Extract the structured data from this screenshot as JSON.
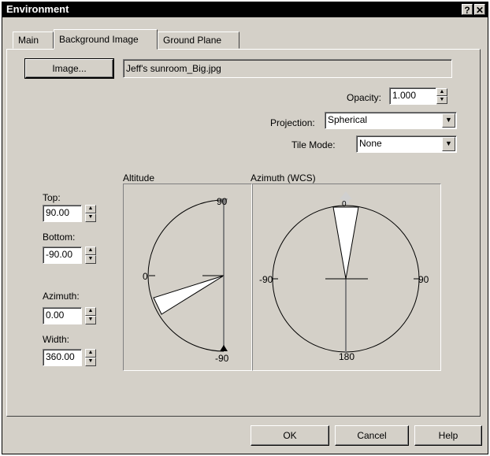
{
  "window": {
    "title": "Environment",
    "help_glyph": "?",
    "close_glyph": "✕"
  },
  "tabs": [
    {
      "label": "Main"
    },
    {
      "label": "Background Image"
    },
    {
      "label": "Ground Plane"
    }
  ],
  "image": {
    "button_label": "Image...",
    "filename": "Jeff's sunroom_Big.jpg"
  },
  "opacity": {
    "label": "Opacity:",
    "value": "1.000"
  },
  "projection": {
    "label": "Projection:",
    "value": "Spherical"
  },
  "tile_mode": {
    "label": "Tile Mode:",
    "value": "None"
  },
  "top": {
    "label": "Top:",
    "value": "90.00"
  },
  "bottom": {
    "label": "Bottom:",
    "value": "-90.00"
  },
  "azimuth": {
    "label": "Azimuth:",
    "value": "0.00"
  },
  "width": {
    "label": "Width:",
    "value": "360.00"
  },
  "altitude_graph": {
    "title": "Altitude",
    "top_label": "90",
    "mid_label": "0",
    "bottom_label": "-90"
  },
  "azimuth_graph": {
    "title": "Azimuth (WCS)",
    "top_label": "0",
    "left_label": "-90",
    "right_label": "90",
    "bottom_label": "180"
  },
  "footer": {
    "ok": "OK",
    "cancel": "Cancel",
    "help": "Help"
  }
}
